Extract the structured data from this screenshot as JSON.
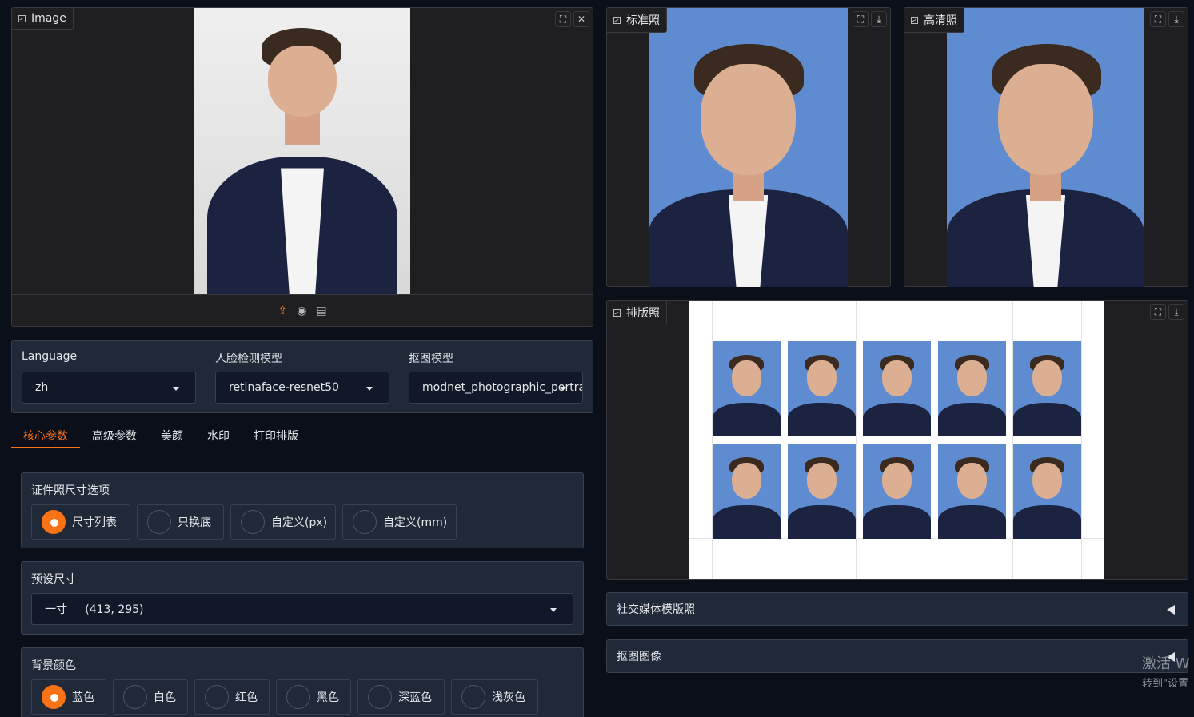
{
  "input_image": {
    "label": "Image"
  },
  "output": {
    "standard": {
      "label": "标准照"
    },
    "hd": {
      "label": "高清照"
    },
    "layout": {
      "label": "排版照"
    }
  },
  "selects": {
    "language": {
      "label": "Language",
      "value": "zh"
    },
    "face_model": {
      "label": "人脸检测模型",
      "value": "retinaface-resnet50"
    },
    "matting_model": {
      "label": "抠图模型",
      "value": "modnet_photographic_portra"
    }
  },
  "tabs": [
    {
      "label": "核心参数",
      "active": true
    },
    {
      "label": "高级参数",
      "active": false
    },
    {
      "label": "美颜",
      "active": false
    },
    {
      "label": "水印",
      "active": false
    },
    {
      "label": "打印排版",
      "active": false
    }
  ],
  "size_option": {
    "title": "证件照尺寸选项",
    "options": [
      "尺寸列表",
      "只换底",
      "自定义(px)",
      "自定义(mm)"
    ],
    "selected": "尺寸列表"
  },
  "preset_size": {
    "title": "预设尺寸",
    "value": "一寸     (413, 295)"
  },
  "bg_color": {
    "title": "背景颜色",
    "options": [
      "蓝色",
      "白色",
      "红色",
      "黑色",
      "深蓝色",
      "浅灰色"
    ],
    "selected": "蓝色"
  },
  "accordions": [
    "社交媒体模版照",
    "抠图图像"
  ],
  "windows_watermark": {
    "line1": "激活 W",
    "line2": "转到\"设置"
  },
  "colors": {
    "accent": "#f97316",
    "photo_bg": "#5f8bd1",
    "page_bg": "#0b0f19",
    "panel": "#1f2937"
  },
  "icons": [
    "fullscreen-icon",
    "close-icon",
    "download-icon",
    "upload-icon",
    "webcam-icon",
    "clipboard-icon",
    "image-icon",
    "caret-down-icon",
    "triangle-left-icon"
  ]
}
